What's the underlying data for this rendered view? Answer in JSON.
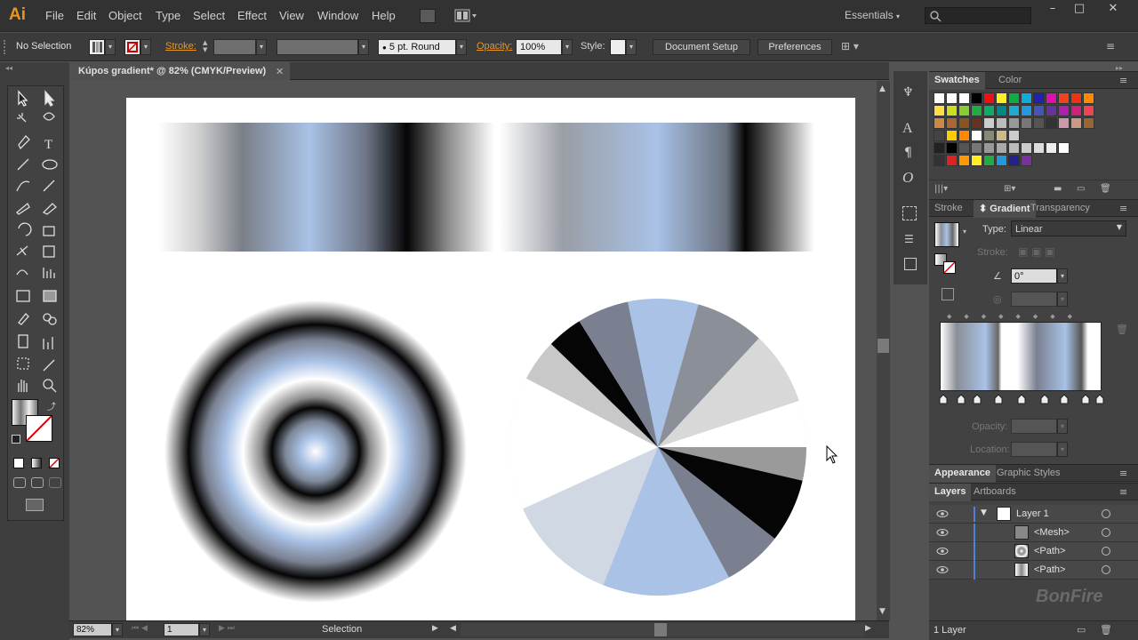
{
  "app": {
    "logo": "Ai"
  },
  "menu": [
    "File",
    "Edit",
    "Object",
    "Type",
    "Select",
    "Effect",
    "View",
    "Window",
    "Help"
  ],
  "workspace": "Essentials",
  "window_controls": [
    "–",
    "□",
    "✕"
  ],
  "control_bar": {
    "selection": "No Selection",
    "stroke_label": "Stroke:",
    "brush": "5 pt. Round",
    "opacity_label": "Opacity:",
    "opacity_value": "100%",
    "style_label": "Style:",
    "document_setup": "Document Setup",
    "preferences": "Preferences"
  },
  "document_tab": {
    "title": "Kúpos gradient* @ 82% (CMYK/Preview)",
    "close": "✕"
  },
  "status_bar": {
    "zoom": "82%",
    "artboard": "1",
    "tool": "Selection"
  },
  "swatches_panel": {
    "tabs": [
      "Swatches",
      "Color"
    ]
  },
  "gradient_panel": {
    "tabs": [
      "Stroke",
      "Gradient",
      "Transparency"
    ],
    "type_label": "Type:",
    "type_value": "Linear",
    "stroke_label": "Stroke:",
    "angle_value": "0°",
    "opacity_label": "Opacity:",
    "location_label": "Location:"
  },
  "appearance_panel": {
    "tabs": [
      "Appearance",
      "Graphic Styles"
    ]
  },
  "layers_panel": {
    "tabs": [
      "Layers",
      "Artboards"
    ],
    "rows": [
      {
        "name": "Layer 1"
      },
      {
        "name": "<Mesh>"
      },
      {
        "name": "<Path>"
      },
      {
        "name": "<Path>"
      }
    ],
    "footer": "1 Layer"
  },
  "watermark": "BonFire",
  "colors": {
    "accent": "#e8961f",
    "bg": "#535353",
    "gradient_blue": "#a7c0e4"
  }
}
